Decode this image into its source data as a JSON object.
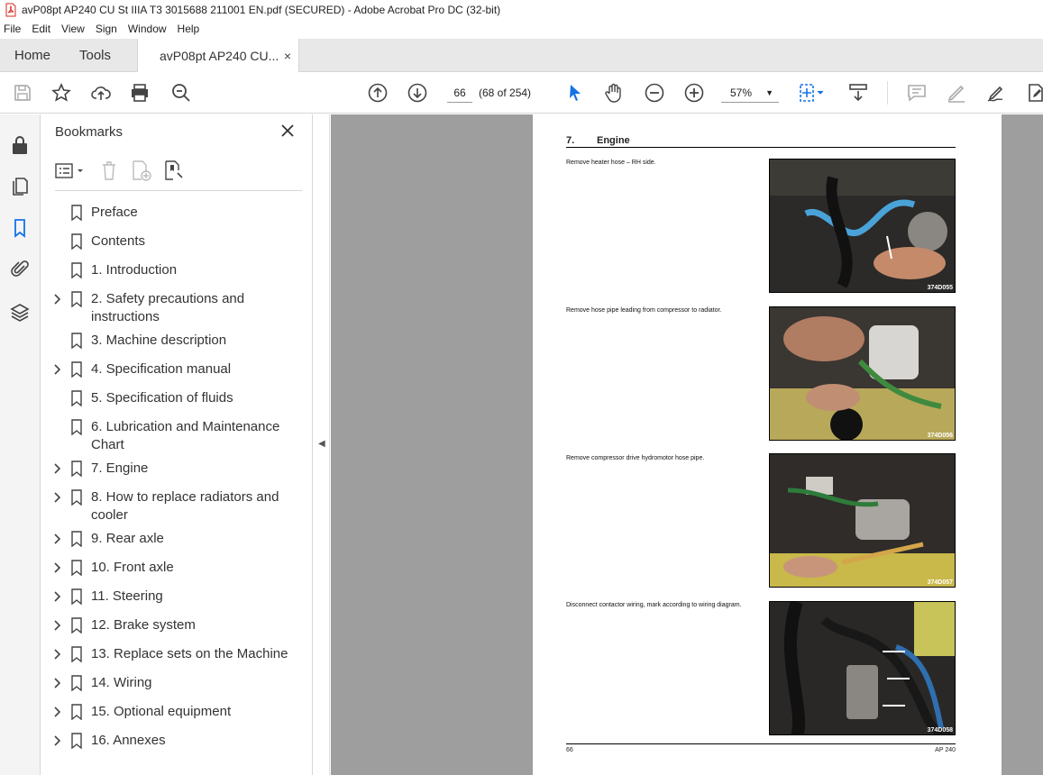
{
  "window": {
    "title": "avP08pt AP240 CU St IIIA T3 3015688 211001 EN.pdf (SECURED) - Adobe Acrobat Pro DC (32-bit)"
  },
  "menu": [
    "File",
    "Edit",
    "View",
    "Sign",
    "Window",
    "Help"
  ],
  "tabs": {
    "home": "Home",
    "tools": "Tools",
    "document": "avP08pt AP240 CU...",
    "close": "×"
  },
  "toolbar": {
    "page_number": "66",
    "page_count": "(68 of 254)",
    "zoom": "57%"
  },
  "bookmarks": {
    "title": "Bookmarks",
    "items": [
      {
        "label": "Preface",
        "expandable": false
      },
      {
        "label": "Contents",
        "expandable": false
      },
      {
        "label": "1. Introduction",
        "expandable": false
      },
      {
        "label": "2. Safety precautions and instructions",
        "expandable": true
      },
      {
        "label": "3. Machine description",
        "expandable": false
      },
      {
        "label": "4. Specification manual",
        "expandable": true
      },
      {
        "label": "5. Specification of fluids",
        "expandable": false
      },
      {
        "label": "6. Lubrication and Maintenance Chart",
        "expandable": false
      },
      {
        "label": "7. Engine",
        "expandable": true
      },
      {
        "label": "8. How to replace radiators and cooler",
        "expandable": true
      },
      {
        "label": "9. Rear axle",
        "expandable": true
      },
      {
        "label": "10. Front axle",
        "expandable": true
      },
      {
        "label": "11. Steering",
        "expandable": true
      },
      {
        "label": "12. Brake system",
        "expandable": true
      },
      {
        "label": "13. Replace sets on the Machine",
        "expandable": true
      },
      {
        "label": "14. Wiring",
        "expandable": true
      },
      {
        "label": "15. Optional equipment",
        "expandable": true
      },
      {
        "label": "16. Annexes",
        "expandable": true
      }
    ]
  },
  "document": {
    "heading_number": "7.",
    "heading_title": "Engine",
    "steps": [
      {
        "text": "Remove heater hose – RH side.",
        "photo_code": "374D055"
      },
      {
        "text": "Remove hose pipe leading from compressor to radiator.",
        "photo_code": "374D056"
      },
      {
        "text": "Remove compressor drive hydromotor hose pipe.",
        "photo_code": "374D057"
      },
      {
        "text": "Disconnect contactor wiring, mark according to wiring diagram.",
        "photo_code": "374D058"
      }
    ],
    "footer_left": "66",
    "footer_right": "AP 240"
  },
  "colors": {
    "accent_blue": "#1473e6",
    "tab_bar": "#e8e8e8",
    "viewer_bg": "#9e9e9e"
  }
}
